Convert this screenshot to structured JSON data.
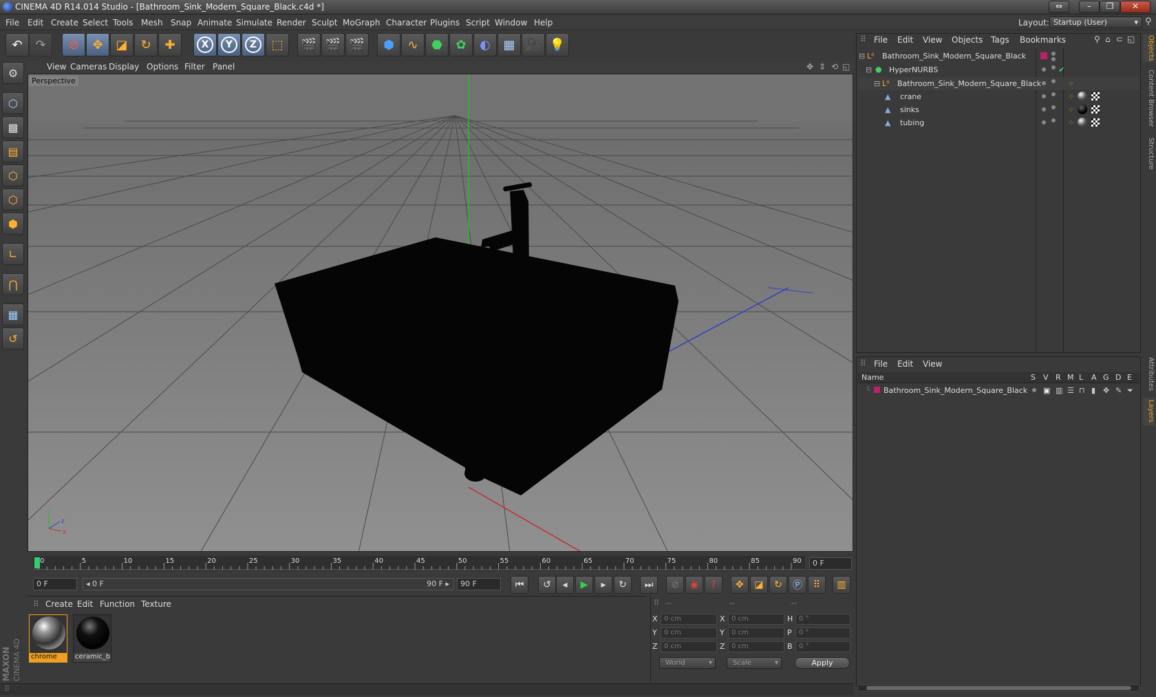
{
  "window": {
    "title": "CINEMA 4D R14.014 Studio - [Bathroom_Sink_Modern_Square_Black.c4d *]"
  },
  "menubar": [
    "File",
    "Edit",
    "Create",
    "Select",
    "Tools",
    "Mesh",
    "Snap",
    "Animate",
    "Simulate",
    "Render",
    "Sculpt",
    "MoGraph",
    "Character",
    "Plugins",
    "Script",
    "Window",
    "Help"
  ],
  "layout": {
    "label": "Layout:",
    "value": "Startup (User)"
  },
  "toolbar": {
    "undo": "undo-icon",
    "redo": "redo-icon",
    "axis_x": "X",
    "axis_y": "Y",
    "axis_z": "Z"
  },
  "viewport": {
    "menu": [
      "View",
      "Cameras",
      "Display",
      "Options",
      "Filter",
      "Panel"
    ],
    "label": "Perspective",
    "axis_labels": {
      "y": "y",
      "z": "z",
      "x": "x"
    }
  },
  "timeline": {
    "ticks": [
      "0",
      "5",
      "10",
      "15",
      "20",
      "25",
      "30",
      "35",
      "40",
      "45",
      "50",
      "55",
      "60",
      "65",
      "70",
      "75",
      "80",
      "85",
      "90"
    ],
    "current_frame": "0 F",
    "start_frame": "0 F",
    "range_start": "0 F",
    "range_end": "90 F",
    "end_frame": "90 F"
  },
  "materials": {
    "menu": [
      "Create",
      "Edit",
      "Function",
      "Texture"
    ],
    "items": [
      {
        "name": "chrome",
        "selected": true
      },
      {
        "name": "ceramic_b",
        "selected": false
      }
    ]
  },
  "coordinates": {
    "headers": [
      "--",
      "--",
      "--"
    ],
    "rows": [
      {
        "pos_label": "X",
        "pos": "0 cm",
        "size_label": "X",
        "size": "0 cm",
        "rot_label": "H",
        "rot": "0 °"
      },
      {
        "pos_label": "Y",
        "pos": "0 cm",
        "size_label": "Y",
        "size": "0 cm",
        "rot_label": "P",
        "rot": "0 °"
      },
      {
        "pos_label": "Z",
        "pos": "0 cm",
        "size_label": "Z",
        "size": "0 cm",
        "rot_label": "B",
        "rot": "0 °"
      }
    ],
    "mode": "World",
    "scale": "Scale",
    "apply": "Apply"
  },
  "objects": {
    "menu": [
      "File",
      "Edit",
      "View",
      "Objects",
      "Tags",
      "Bookmarks"
    ],
    "tree": [
      {
        "name": "Bathroom_Sink_Modern_Square_Black",
        "indent": 0
      },
      {
        "name": "HyperNURBS",
        "indent": 1
      },
      {
        "name": "Bathroom_Sink_Modern_Square_Black",
        "indent": 2
      },
      {
        "name": "crane",
        "indent": 3
      },
      {
        "name": "sinks",
        "indent": 3
      },
      {
        "name": "tubing",
        "indent": 3
      }
    ]
  },
  "layers": {
    "menu": [
      "File",
      "Edit",
      "View"
    ],
    "columns": [
      "Name",
      "S",
      "V",
      "R",
      "M",
      "L",
      "A",
      "G",
      "D",
      "E"
    ],
    "rows": [
      {
        "name": "Bathroom_Sink_Modern_Square_Black",
        "color": "#c0206a"
      }
    ]
  },
  "right_tabs": [
    "Objects",
    "Content Browser",
    "Structure",
    "Attributes",
    "Layers"
  ],
  "colors": {
    "accent_orange": "#f0a020",
    "layer_magenta": "#c0206a",
    "axis_green": "#20c020",
    "axis_red": "#c03030",
    "axis_blue": "#3040c0"
  },
  "branding": {
    "maxon": "MAXON",
    "product": "CINEMA 4D"
  }
}
